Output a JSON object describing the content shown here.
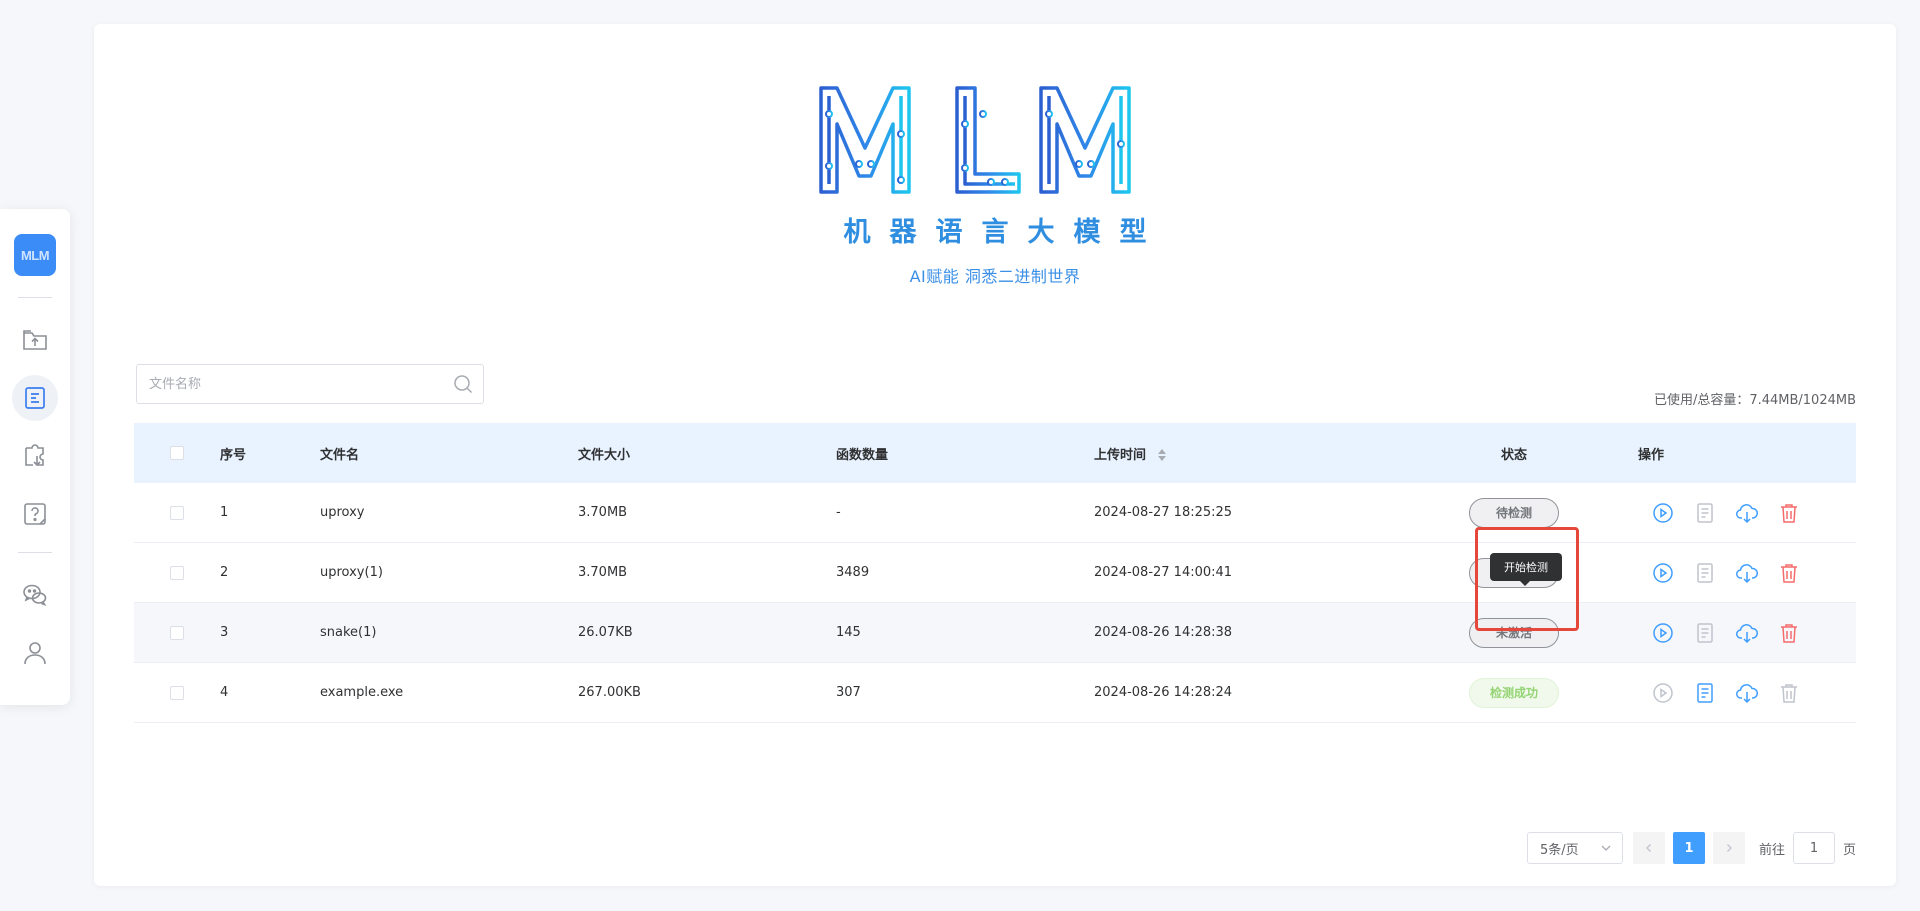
{
  "sidebar": {
    "logo_text": "MLM",
    "items": [
      {
        "name": "upload-folder-icon"
      },
      {
        "name": "file-list-icon",
        "active": true
      },
      {
        "name": "puzzle-download-icon"
      },
      {
        "name": "help-icon"
      },
      {
        "name": "wechat-icon"
      },
      {
        "name": "user-icon"
      }
    ]
  },
  "hero": {
    "logo_text": "MLM",
    "title": "机器语言大模型",
    "subtitle": "AI赋能 洞悉二进制世界"
  },
  "search": {
    "placeholder": "文件名称"
  },
  "usage": "已使用/总容量：7.44MB/1024MB",
  "table": {
    "headers": {
      "index": "序号",
      "name": "文件名",
      "size": "文件大小",
      "functions": "函数数量",
      "upload_time": "上传时间",
      "status": "状态",
      "actions": "操作"
    },
    "rows": [
      {
        "index": "1",
        "name": "uproxy",
        "size": "3.70MB",
        "functions": "-",
        "upload_time": "2024-08-27 18:25:25",
        "status": "待检测"
      },
      {
        "index": "2",
        "name": "uproxy(1)",
        "size": "3.70MB",
        "functions": "3489",
        "upload_time": "2024-08-27 14:00:41",
        "status": "未激活"
      },
      {
        "index": "3",
        "name": "snake(1)",
        "size": "26.07KB",
        "functions": "145",
        "upload_time": "2024-08-26 14:28:38",
        "status": "未激活"
      },
      {
        "index": "4",
        "name": "example.exe",
        "size": "267.00KB",
        "functions": "307",
        "upload_time": "2024-08-26 14:28:24",
        "status": "检测成功"
      }
    ]
  },
  "tooltip": "开始检测",
  "pagination": {
    "page_size": "5条/页",
    "current_page": "1",
    "goto_label": "前往",
    "goto_value": "1",
    "page_suffix": "页"
  },
  "colors": {
    "accent": "#409eff",
    "danger": "#f56c6c",
    "success": "#95d475",
    "highlight": "#e5473b"
  }
}
